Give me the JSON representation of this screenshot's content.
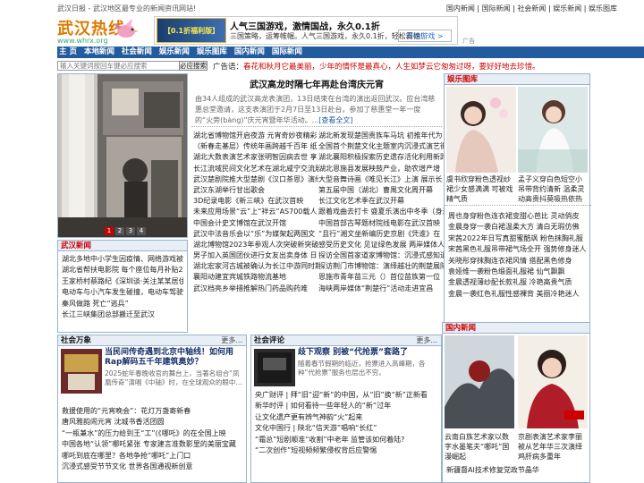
{
  "top": {
    "intro": "武汉日报 - 武汉地区最专业的新闻资讯网站!",
    "links": [
      "国内新闻",
      "国际新闻",
      "社会新闻",
      "娱乐新闻",
      "娱乐图库"
    ]
  },
  "logo": {
    "name": "武汉热线",
    "url": "www.whrx.org"
  },
  "ad": {
    "thumb": "【0.1折福利版】",
    "title": "人气三国游戏，激情国战，永久0.1折",
    "desc": "三国策略，运筹帷幄。人气三国游戏，永久0.1折，轻松霸榜!",
    "button": "开始游戏 >",
    "tag": "广告"
  },
  "nav": [
    "主 页",
    "本地新闻",
    "社会新闻",
    "娱乐新闻",
    "娱乐图库",
    "国内新闻",
    "国际新闻"
  ],
  "search": {
    "placeholder": "输入关键词按回车键必应搜索",
    "button": "必应搜索"
  },
  "notice": {
    "label": "广告语：",
    "text": "春花和秋月它最美丽，少年的情怀是最真心，人生如梦云它匆匆过呀，要好好地去珍惜。"
  },
  "photo": {
    "pages": [
      "1",
      "2",
      "3",
      "4"
    ]
  },
  "headline": {
    "title": "武汉高龙时隔七年再赴台湾庆元宵",
    "summary": "由34人组成的武汉高龙表演团，13日结束在台湾的演出返回武汉。应台湾慈惠总堂邀请，这支表演团于2月7日至13日赴台，参加了慈惠堂一年一度的“火旁(bàng)”庆元宵暨年华活动。...",
    "more": "[查看全文]"
  },
  "news_rows": [
    [
      "湖北省博物馆开启夜游  元宵奇妙夜精彩",
      "湖北新发现楚国贵族车马坑 初推年代为"
    ],
    [
      "（新春走基层）传统年画跨越千百年 纸",
      "全国首个荆楚文化主题室内沉浸式演艺街"
    ],
    [
      "湖北大数表演艺术家张明智因病去世 享",
      "湖北襄阳积极探索历史遗存活化利用新路"
    ],
    [
      "长江流域民间文化艺术在湖北咸宁交流展",
      "湖北恩施县发展秧鼓产业，助农增产增"
    ],
    [
      "武汉楚剧院推大型楚剧《汉口茶恩》演绎",
      "大型音舞诗画《唯见长江》上演 展示长"
    ],
    [
      "武汉东湖举行甘出歌会",
      "第五届中国（湖北）曹禺文化周开幕"
    ],
    [
      "3D纪录电影《新三峡》在武汉首映",
      "长江文化艺术季在武汉开幕"
    ],
    [
      "未来应用场景“云”上“祥云”AS700载人",
      "跟着戏曲去打卡  盛夏乐演出中冬季（身边"
    ],
    [
      "中国会计史文博馆在武汉开馆",
      "中国首部古琴题材院线电影在武汉首映"
    ],
    [
      "武汉中法音乐会以“乐”为媒架起两国文",
      "“且行”湘文坐新编历史京剧《凭谁》在"
    ],
    [
      "湖北博物馆2023年参观人次突破新突破",
      "感受历史文化 见证绿色发展 两岸媒体人"
    ],
    [
      "男子加入英国团伙进行女友出卖身体 日",
      "探访全国首家道家博物馆：沉浸式感知道"
    ],
    [
      "湖北宏家河古城被确认为长江中游同时期",
      "探访荆门市博物馆：演绎越壮的荆楚展陈"
    ],
    [
      "襄阳动建宜宾城铁路物流基地",
      "恩施市青年苗三元（）首位苗族第一位"
    ],
    [
      "武汉档亮乡举措推解热门药品购药难",
      "海峡两岸媒体“荆楚行”活动走进宜昌"
    ]
  ],
  "wuhan_news": {
    "title": "武汉新闻",
    "items": [
      "湖北多地中小学生因疫情、网络游戏被骗",
      "湖北省帮扶电影院 每个座位每月补贴25",
      "王家桥村蔡路纪《深圳谈·关注某某居住主",
      "电动车与小汽车发生碰撞，电动车驾驶员",
      "秦风做路 死亡“逃兵”",
      "长江三峡集团总部搬迁至武汉"
    ]
  },
  "ent_pics": {
    "title": "娱乐图库",
    "items": [
      {
        "caption": "虞书欣穿粉色透视纱裙少女感满满 可被戏精气质"
      },
      {
        "caption": "孟子义穿白色短空小吊带背约清新 温柔灵动高贵抖莫吸热依热"
      }
    ],
    "list": [
      "周也身穿粉色连衣裙变甜心芭比 灵动俏皮",
      "金晨身穿一袭白裙温柔大方 清白无瑕仿佛",
      "宋茜2022年日写真甜蜜酷飒 粉色抹胸礼服",
      "宋茜黑色礼服吊带裙气场全开 强势修身迷人",
      "关晓彤穿抹胸连衣裙风情 搭配黑色修身",
      "袁娅维一袭粉色缎面礼服裙 仙气飘飘",
      "金晨透视薄纱配长款礼服 冷艳高贵气质",
      "金晨一袭红色礼服性感裸背 美丽冷艳迷人"
    ]
  },
  "society": {
    "title": "社会万象",
    "more": "更多...",
    "feature_title": "当民间传奇遇到北京中轴线！如何用Rap解码五千年建筑奥妙？",
    "feature_desc": "2025蛇年春晚收官的舞台上，当著名组合“凤凰传奇”演唱《中轴》时，在全球观众的眼中...",
    "items": [
      "救援使用的“元宵晚会”：花灯万盏寄新春",
      "唐风雅韵闹元宵 沈城书香活团圆",
      "“一瓶兼水”的压力给到王“工”(《哪吒》的在全国上映",
      "中国各地“认领”哪吒紧张 专家建言准数影里的美丽宝藏",
      "哪吒到底在哪里？各地争抢“哪吒”上门口",
      "沉浸式感受节节文化 世界各国通视新创意"
    ]
  },
  "comment": {
    "title": "社会评论",
    "more": "更多...",
    "feature_title": "歧下观察 别被“代抢票”套路了",
    "feature_desc": "随着春节假期的临近，抢票进入高峰期，各种“代抢票”服务也层出不穷。",
    "items": [
      "央广财评 | 拜“旧”迎“新”的中国，从“旧”换“新”正新看",
      "新华时评 | 如何看待一些年轻人的“新”过年",
      "让文化遗产更有辨气神韵“火”起来",
      "文化中国行 | 陕北“信天游”唱响“长红”",
      "“霜总”短剧顺准“收割”中老年 监管该如何着陆?",
      "“二次创作”短视频频繁侵权背后应警惕"
    ]
  },
  "domestic": {
    "title": "国内新闻",
    "items": [
      {
        "caption": "云南白族艺术家以数字水墨笔夫“哪吒”国漫崛起"
      },
      {
        "caption": "京剧表演艺术家李丽被从艺年华三次演绎鸡肝病多重年"
      }
    ],
    "list": [
      "新疆督AI技术修复党政节晶华"
    ]
  }
}
